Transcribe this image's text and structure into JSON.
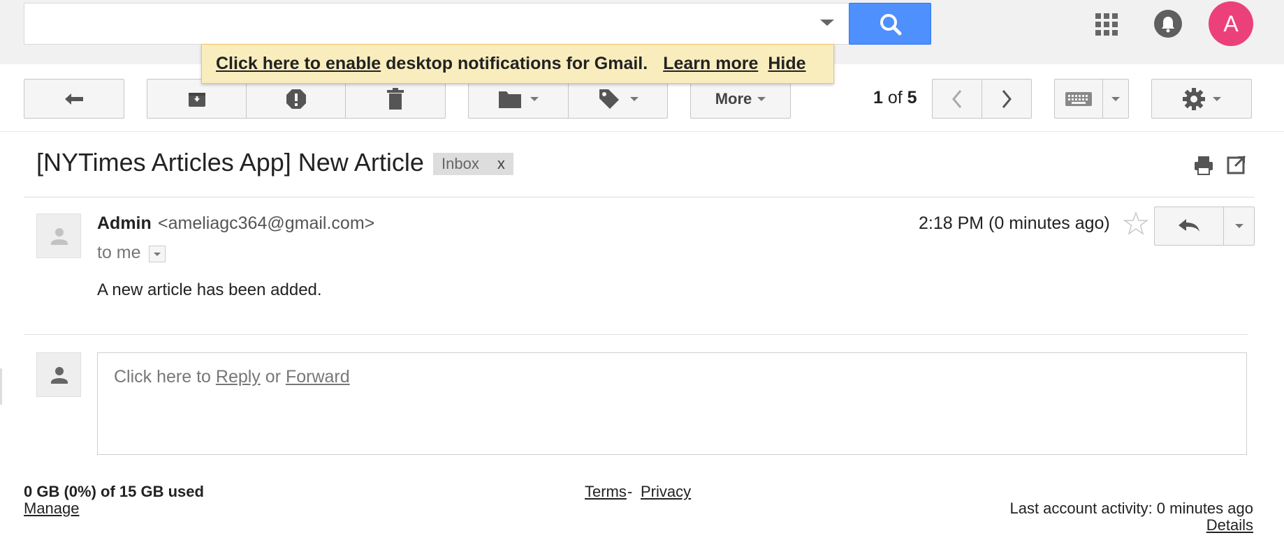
{
  "search": {
    "placeholder": ""
  },
  "header": {
    "avatar_letter": "A",
    "accent_color": "#4d90fe",
    "avatar_color": "#ec407a"
  },
  "notification": {
    "enable_link": "Click here to enable",
    "text": " desktop notifications for Gmail.",
    "learn_more": "Learn more",
    "hide": "Hide"
  },
  "toolbar": {
    "more_label": "More",
    "page_current": "1",
    "page_of": " of ",
    "page_total": "5"
  },
  "thread": {
    "subject": "[NYTimes Articles App] New Article",
    "label": "Inbox",
    "label_remove": "x"
  },
  "message": {
    "sender_name": "Admin",
    "sender_email": "<ameliagc364@gmail.com>",
    "to_line": "to me",
    "timestamp": "2:18 PM (0 minutes ago)",
    "body": "A new article has been added."
  },
  "reply_box": {
    "prefix": "Click here to ",
    "reply": "Reply",
    "or": " or ",
    "forward": "Forward"
  },
  "footer": {
    "storage": "0 GB (0%) of 15 GB used",
    "manage": "Manage",
    "terms": "Terms",
    "sep": "-",
    "privacy": "Privacy",
    "last_activity": "Last account activity: 0 minutes ago",
    "details": "Details"
  }
}
